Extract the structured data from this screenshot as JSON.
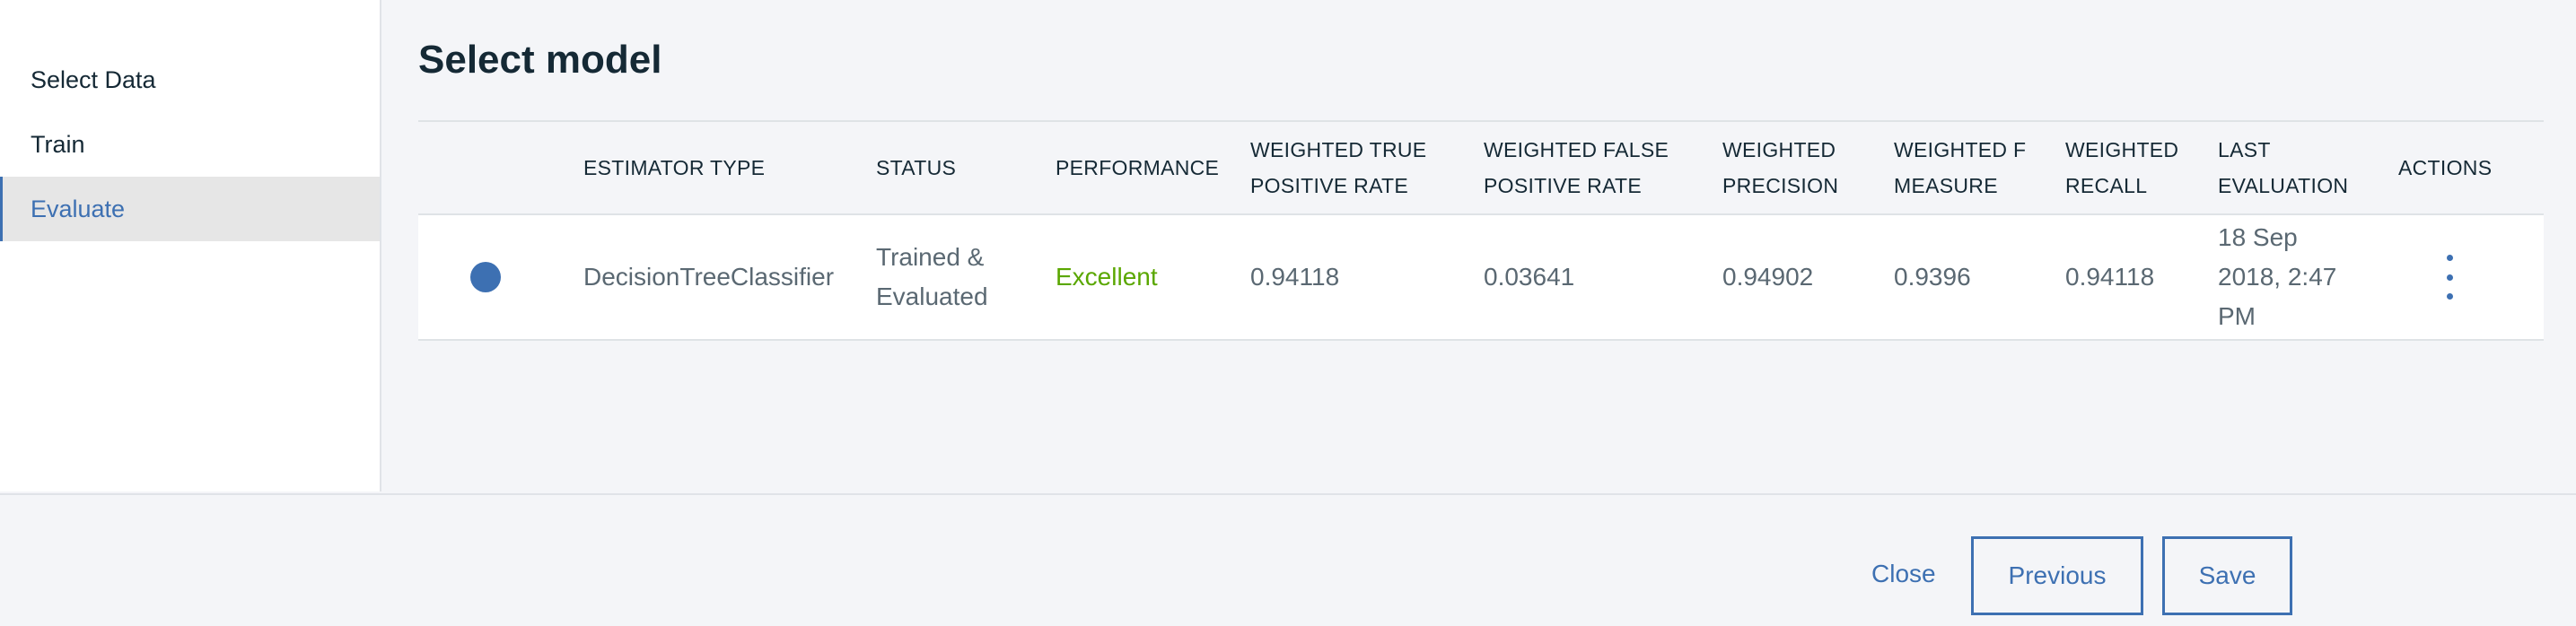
{
  "sidebar": {
    "items": [
      {
        "label": "Select Data",
        "active": false
      },
      {
        "label": "Train",
        "active": false
      },
      {
        "label": "Evaluate",
        "active": true
      }
    ]
  },
  "main": {
    "title": "Select model",
    "table": {
      "headers": [
        "ESTIMATOR TYPE",
        "STATUS",
        "PERFORMANCE",
        "WEIGHTED TRUE\nPOSITIVE RATE",
        "WEIGHTED FALSE\nPOSITIVE RATE",
        "WEIGHTED\nPRECISION",
        "WEIGHTED F\nMEASURE",
        "WEIGHTED\nRECALL",
        "LAST\nEVALUATION",
        "ACTIONS"
      ],
      "rows": [
        {
          "estimator_type": "DecisionTreeClassifier",
          "status": "Trained & Evaluated",
          "performance": "Excellent",
          "weighted_tpr": "0.94118",
          "weighted_fpr": "0.03641",
          "weighted_precision": "0.94902",
          "weighted_f_measure": "0.9396",
          "weighted_recall": "0.94118",
          "last_evaluation": "18 Sep 2018, 2:47 PM",
          "selected": true
        }
      ]
    }
  },
  "footer": {
    "close_label": "Close",
    "previous_label": "Previous",
    "save_label": "Save"
  },
  "colors": {
    "accent": "#3d70b2",
    "performance_good": "#5aa700",
    "background": "#f4f5f8"
  },
  "icons": {
    "row_select": "radio-selected-icon",
    "row_actions": "overflow-menu-icon"
  }
}
